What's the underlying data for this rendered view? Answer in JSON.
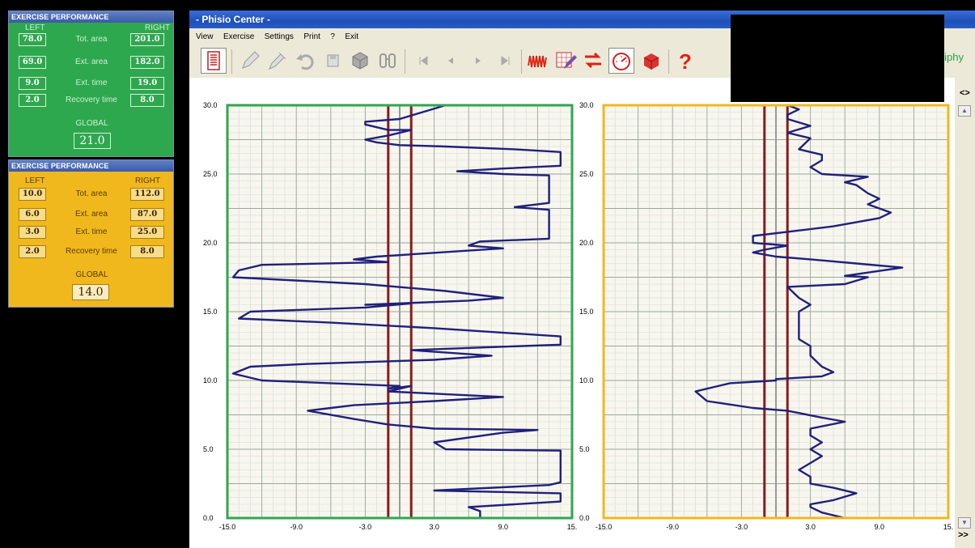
{
  "perf_left": {
    "title": "EXERCISE PERFORMANCE",
    "left_label": "LEFT",
    "right_label": "RIGHT",
    "rows": [
      {
        "label": "Tot. area",
        "left": "78.0",
        "right": "201.0"
      },
      {
        "label": "Ext. area",
        "left": "69.0",
        "right": "182.0"
      },
      {
        "label": "Ext. time",
        "left": "9.0",
        "right": "19.0"
      },
      {
        "label": "Recovery time",
        "left": "2.0",
        "right": "8.0"
      }
    ],
    "global_label": "GLOBAL",
    "global_value": "21.0",
    "color": "#2ea84e"
  },
  "perf_right": {
    "title": "EXERCISE PERFORMANCE",
    "left_label": "LEFT",
    "right_label": "RIGHT",
    "rows": [
      {
        "label": "Tot. area",
        "left": "10.0",
        "right": "112.0"
      },
      {
        "label": "Ext. area",
        "left": "6.0",
        "right": "87.0"
      },
      {
        "label": "Ext. time",
        "left": "3.0",
        "right": "25.0"
      },
      {
        "label": "Recovery time",
        "left": "2.0",
        "right": "8.0"
      }
    ],
    "global_label": "GLOBAL",
    "global_value": "14.0",
    "color": "#f0b81c"
  },
  "window": {
    "title": "- Phisio Center -",
    "menu": [
      "View",
      "Exercise",
      "Settings",
      "Print",
      "?",
      "Exit"
    ],
    "product_text": "niphy",
    "toolbar_icons": [
      "chart-record-icon",
      "pencil-icon",
      "pencil-edit-icon",
      "undo-icon",
      "save-icon",
      "box-icon",
      "binoculars-icon",
      "first-icon",
      "prev-icon",
      "next-icon",
      "last-icon",
      "waveform-icon",
      "chart-edit-icon",
      "swap-icon",
      "gauge-icon",
      "cube-icon",
      "help-icon"
    ],
    "scroll_top_label": "<>",
    "scroll_bottom_label": ">>"
  },
  "chart_data": [
    {
      "type": "line",
      "name": "left-plot",
      "border_color": "#2ea84e",
      "xlim": [
        -15,
        15
      ],
      "ylim": [
        0,
        30
      ],
      "x_ticks": [
        "-15.0",
        "-9.0",
        "-3.0",
        "3.0",
        "9.0",
        "15."
      ],
      "y_ticks": [
        "0.0",
        "5.0",
        "10.0",
        "15.0",
        "20.0",
        "25.0",
        "30.0"
      ],
      "reference_lines": [
        {
          "x": -1.0,
          "color": "#8b1a1a"
        },
        {
          "x": 0.0,
          "color": "#999999"
        },
        {
          "x": 1.0,
          "color": "#8b1a1a"
        }
      ],
      "grid": true,
      "series": [
        {
          "color": "#20207a",
          "points": [
            [
              7,
              0.0
            ],
            [
              7,
              0.5
            ],
            [
              6,
              0.8
            ],
            [
              14,
              1.2
            ],
            [
              14,
              1.8
            ],
            [
              3,
              2.0
            ],
            [
              13,
              2.4
            ],
            [
              14,
              2.6
            ],
            [
              14,
              4.9
            ],
            [
              4,
              5.0
            ],
            [
              3,
              5.5
            ],
            [
              9,
              6.2
            ],
            [
              12,
              6.4
            ],
            [
              3,
              6.5
            ],
            [
              -1,
              6.8
            ],
            [
              -4,
              7.2
            ],
            [
              -8,
              7.8
            ],
            [
              -6,
              8.0
            ],
            [
              -4,
              8.2
            ],
            [
              3,
              8.5
            ],
            [
              9,
              8.8
            ],
            [
              -1,
              9.2
            ],
            [
              1,
              9.6
            ],
            [
              -1,
              9.4
            ],
            [
              0,
              9.6
            ],
            [
              -6,
              9.8
            ],
            [
              -12,
              10.0
            ],
            [
              -14.5,
              10.5
            ],
            [
              -13,
              11.0
            ],
            [
              -8,
              11.2
            ],
            [
              3,
              11.5
            ],
            [
              8,
              11.8
            ],
            [
              1,
              12.2
            ],
            [
              4,
              12.3
            ],
            [
              14,
              12.6
            ],
            [
              14,
              13.2
            ],
            [
              3,
              13.8
            ],
            [
              -6,
              14.2
            ],
            [
              -14,
              14.5
            ],
            [
              -13,
              15.0
            ],
            [
              -3,
              15.3
            ],
            [
              1,
              15.6
            ],
            [
              -3,
              15.5
            ],
            [
              6,
              15.8
            ],
            [
              9,
              16.0
            ],
            [
              4,
              16.5
            ],
            [
              -3,
              17.0
            ],
            [
              -14.5,
              17.5
            ],
            [
              -14,
              18.0
            ],
            [
              -12,
              18.4
            ],
            [
              -1,
              18.6
            ],
            [
              -4,
              18.8
            ],
            [
              -2,
              19.0
            ],
            [
              9,
              19.6
            ],
            [
              6,
              19.8
            ],
            [
              7,
              20.1
            ],
            [
              13,
              20.3
            ],
            [
              13,
              22.4
            ],
            [
              10,
              22.6
            ],
            [
              13,
              22.9
            ],
            [
              13,
              24.9
            ],
            [
              9,
              25.0
            ],
            [
              5,
              25.2
            ],
            [
              9,
              25.4
            ],
            [
              14,
              25.6
            ],
            [
              14,
              26.6
            ],
            [
              10,
              26.8
            ],
            [
              4,
              27.0
            ],
            [
              0,
              27.1
            ],
            [
              -2,
              27.3
            ],
            [
              -3,
              27.5
            ],
            [
              -1,
              27.8
            ],
            [
              1,
              28.2
            ],
            [
              -1,
              28.2
            ],
            [
              -3,
              28.6
            ],
            [
              -3,
              28.8
            ],
            [
              0,
              29.0
            ],
            [
              2,
              29.5
            ],
            [
              4,
              30.0
            ]
          ]
        }
      ]
    },
    {
      "type": "line",
      "name": "right-plot",
      "border_color": "#f0b81c",
      "xlim": [
        -15,
        15
      ],
      "ylim": [
        0,
        30
      ],
      "x_ticks": [
        "-15.0",
        "-9.0",
        "-3.0",
        "3.0",
        "9.0",
        "15."
      ],
      "y_ticks": [
        "0.0",
        "5.0",
        "10.0",
        "15.0",
        "20.0",
        "25.0",
        "30.0"
      ],
      "reference_lines": [
        {
          "x": -1.0,
          "color": "#8b1a1a"
        },
        {
          "x": 0.0,
          "color": "#999999"
        },
        {
          "x": 1.0,
          "color": "#8b1a1a"
        }
      ],
      "grid": true,
      "series": [
        {
          "color": "#20207a",
          "points": [
            [
              6,
              0.0
            ],
            [
              4,
              0.4
            ],
            [
              3,
              0.8
            ],
            [
              3,
              1.0
            ],
            [
              5,
              1.3
            ],
            [
              7,
              1.8
            ],
            [
              5,
              2.2
            ],
            [
              3,
              2.5
            ],
            [
              3,
              3.0
            ],
            [
              2,
              3.5
            ],
            [
              3,
              4.0
            ],
            [
              4,
              4.5
            ],
            [
              3,
              5.0
            ],
            [
              4,
              5.5
            ],
            [
              3,
              6.0
            ],
            [
              3,
              6.5
            ],
            [
              6,
              7.0
            ],
            [
              4,
              7.3
            ],
            [
              1,
              7.8
            ],
            [
              -2,
              8.0
            ],
            [
              -6,
              8.5
            ],
            [
              -7,
              9.2
            ],
            [
              -4,
              9.8
            ],
            [
              0,
              10.0
            ],
            [
              0,
              10.1
            ],
            [
              4,
              10.3
            ],
            [
              5,
              10.6
            ],
            [
              4,
              11.0
            ],
            [
              3,
              11.8
            ],
            [
              3,
              12.5
            ],
            [
              2,
              13.0
            ],
            [
              2,
              14.0
            ],
            [
              2,
              15.0
            ],
            [
              3,
              15.5
            ],
            [
              2,
              16.0
            ],
            [
              1,
              16.8
            ],
            [
              6,
              17.0
            ],
            [
              8,
              17.5
            ],
            [
              6,
              17.6
            ],
            [
              11,
              18.2
            ],
            [
              7,
              18.5
            ],
            [
              3,
              18.8
            ],
            [
              0,
              19.0
            ],
            [
              -2,
              19.3
            ],
            [
              -1,
              19.5
            ],
            [
              1,
              19.8
            ],
            [
              -2,
              20.0
            ],
            [
              -2,
              20.5
            ],
            [
              1,
              20.8
            ],
            [
              5,
              21.2
            ],
            [
              9,
              21.8
            ],
            [
              10,
              22.2
            ],
            [
              8,
              22.8
            ],
            [
              9,
              23.2
            ],
            [
              8,
              23.6
            ],
            [
              7,
              24.2
            ],
            [
              6,
              24.4
            ],
            [
              8,
              24.8
            ],
            [
              4,
              25.0
            ],
            [
              3,
              25.5
            ],
            [
              4,
              26.0
            ],
            [
              4,
              26.4
            ],
            [
              3,
              26.6
            ],
            [
              2,
              26.8
            ],
            [
              3,
              27.6
            ],
            [
              1,
              28.0
            ],
            [
              3,
              28.5
            ],
            [
              1,
              29.0
            ],
            [
              1,
              29.3
            ],
            [
              2,
              29.7
            ],
            [
              1,
              30.0
            ]
          ]
        }
      ]
    }
  ]
}
